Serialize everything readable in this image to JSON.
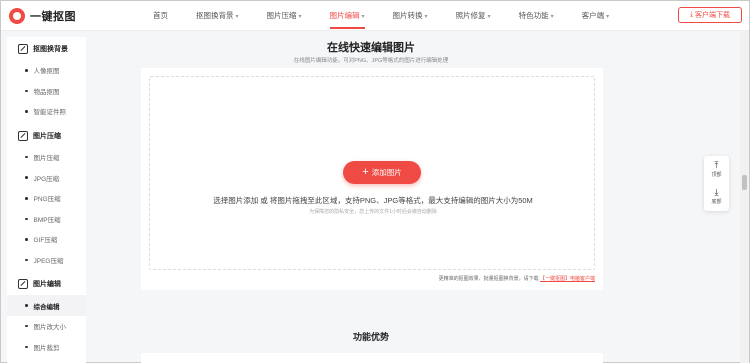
{
  "header": {
    "logo_text": "一键抠图",
    "nav": [
      {
        "label": "首页",
        "caret": false,
        "active": false
      },
      {
        "label": "抠图换背景",
        "caret": true,
        "active": false
      },
      {
        "label": "图片压缩",
        "caret": true,
        "active": false
      },
      {
        "label": "图片编辑",
        "caret": true,
        "active": true
      },
      {
        "label": "图片转换",
        "caret": true,
        "active": false
      },
      {
        "label": "照片修复",
        "caret": true,
        "active": false
      },
      {
        "label": "特色功能",
        "caret": true,
        "active": false
      },
      {
        "label": "客户端",
        "caret": true,
        "active": false
      }
    ],
    "download_label": "客户端下载",
    "accent_color": "#ef4a43"
  },
  "sidebar": {
    "sections": [
      {
        "title": "抠图换背景",
        "items": [
          "人像抠图",
          "物品抠图",
          "智能证件照"
        ]
      },
      {
        "title": "图片压缩",
        "items": [
          "图片压缩",
          "JPG压缩",
          "PNG压缩",
          "BMP压缩",
          "GIF压缩",
          "JPEG压缩"
        ]
      },
      {
        "title": "图片编辑",
        "items": [
          "综合编辑",
          "图片改大小",
          "图片裁剪"
        ]
      }
    ],
    "active_item": "综合编辑"
  },
  "main": {
    "title": "在线快速编辑图片",
    "subtitle": "在线图片编辑功能，可对PNG、JPG等格式的图片进行编辑处理",
    "add_button": "添加图片",
    "drop_text": "选择图片添加 或 将图片拖拽至此区域，支持PNG、JPG等格式，最大支持编辑的图片大小为50M",
    "drop_note": "为保障您的隐私安全，您上传的文件1小时后会被自动删除",
    "tip_prefix": "更精准的抠图效果、批量抠图换背景，请下载",
    "tip_link": "【一键抠图】电脑客户端",
    "advantages_title": "功能优势"
  },
  "float_tools": {
    "top_label": "顶部",
    "bottom_label": "底部"
  }
}
